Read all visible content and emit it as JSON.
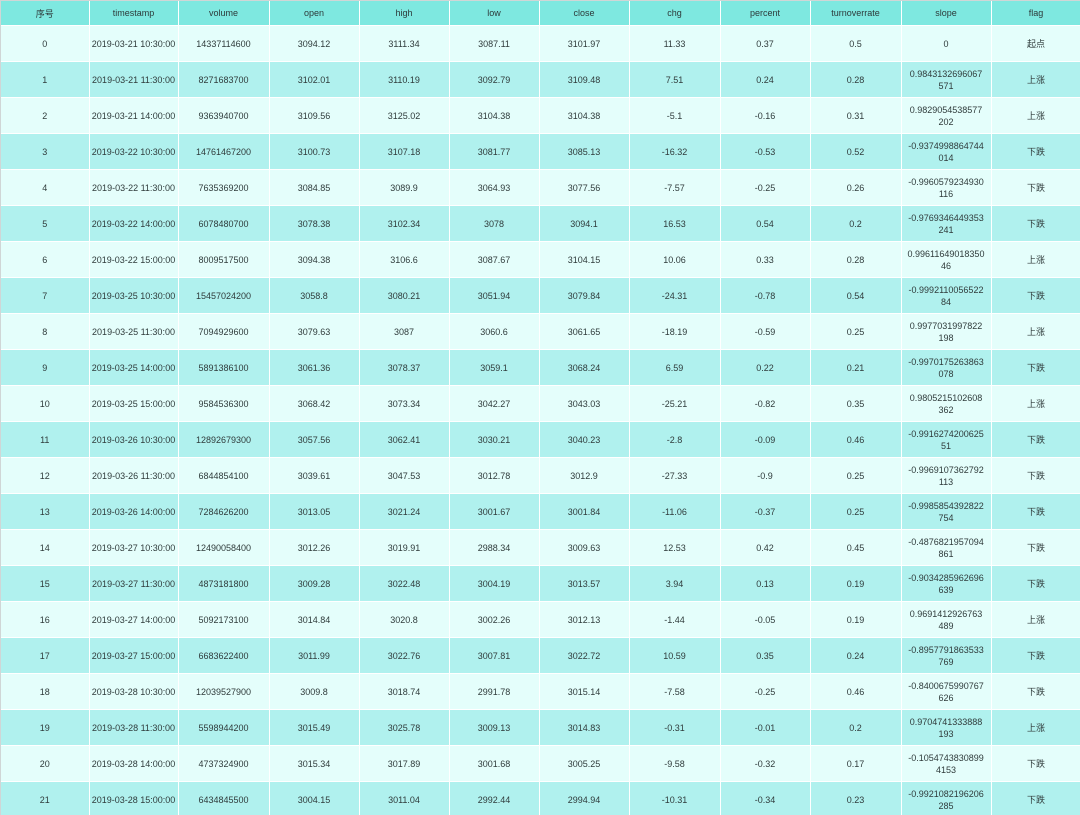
{
  "table": {
    "columns": [
      "序号",
      "timestamp",
      "volume",
      "open",
      "high",
      "low",
      "close",
      "chg",
      "percent",
      "turnoverrate",
      "slope",
      "flag"
    ],
    "rows": [
      [
        "0",
        "2019-03-21 10:30:00",
        "14337114600",
        "3094.12",
        "3111.34",
        "3087.11",
        "3101.97",
        "11.33",
        "0.37",
        "0.5",
        "0",
        "起点"
      ],
      [
        "1",
        "2019-03-21 11:30:00",
        "8271683700",
        "3102.01",
        "3110.19",
        "3092.79",
        "3109.48",
        "7.51",
        "0.24",
        "0.28",
        "0.9843132696067571",
        "上涨"
      ],
      [
        "2",
        "2019-03-21 14:00:00",
        "9363940700",
        "3109.56",
        "3125.02",
        "3104.38",
        "3104.38",
        "-5.1",
        "-0.16",
        "0.31",
        "0.9829054538577202",
        "上涨"
      ],
      [
        "3",
        "2019-03-22 10:30:00",
        "14761467200",
        "3100.73",
        "3107.18",
        "3081.77",
        "3085.13",
        "-16.32",
        "-0.53",
        "0.52",
        "-0.9374998864744014",
        "下跌"
      ],
      [
        "4",
        "2019-03-22 11:30:00",
        "7635369200",
        "3084.85",
        "3089.9",
        "3064.93",
        "3077.56",
        "-7.57",
        "-0.25",
        "0.26",
        "-0.9960579234930116",
        "下跌"
      ],
      [
        "5",
        "2019-03-22 14:00:00",
        "6078480700",
        "3078.38",
        "3102.34",
        "3078",
        "3094.1",
        "16.53",
        "0.54",
        "0.2",
        "-0.9769346449353241",
        "下跌"
      ],
      [
        "6",
        "2019-03-22 15:00:00",
        "8009517500",
        "3094.38",
        "3106.6",
        "3087.67",
        "3104.15",
        "10.06",
        "0.33",
        "0.28",
        "0.9961164901835046",
        "上涨"
      ],
      [
        "7",
        "2019-03-25 10:30:00",
        "15457024200",
        "3058.8",
        "3080.21",
        "3051.94",
        "3079.84",
        "-24.31",
        "-0.78",
        "0.54",
        "-0.999211005652284",
        "下跌"
      ],
      [
        "8",
        "2019-03-25 11:30:00",
        "7094929600",
        "3079.63",
        "3087",
        "3060.6",
        "3061.65",
        "-18.19",
        "-0.59",
        "0.25",
        "0.9977031997822198",
        "上涨"
      ],
      [
        "9",
        "2019-03-25 14:00:00",
        "5891386100",
        "3061.36",
        "3078.37",
        "3059.1",
        "3068.24",
        "6.59",
        "0.22",
        "0.21",
        "-0.9970175263863078",
        "下跌"
      ],
      [
        "10",
        "2019-03-25 15:00:00",
        "9584536300",
        "3068.42",
        "3073.34",
        "3042.27",
        "3043.03",
        "-25.21",
        "-0.82",
        "0.35",
        "0.9805215102608362",
        "上涨"
      ],
      [
        "11",
        "2019-03-26 10:30:00",
        "12892679300",
        "3057.56",
        "3062.41",
        "3030.21",
        "3040.23",
        "-2.8",
        "-0.09",
        "0.46",
        "-0.991627420062551",
        "下跌"
      ],
      [
        "12",
        "2019-03-26 11:30:00",
        "6844854100",
        "3039.61",
        "3047.53",
        "3012.78",
        "3012.9",
        "-27.33",
        "-0.9",
        "0.25",
        "-0.9969107362792113",
        "下跌"
      ],
      [
        "13",
        "2019-03-26 14:00:00",
        "7284626200",
        "3013.05",
        "3021.24",
        "3001.67",
        "3001.84",
        "-11.06",
        "-0.37",
        "0.25",
        "-0.9985854392822754",
        "下跌"
      ],
      [
        "14",
        "2019-03-27 10:30:00",
        "12490058400",
        "3012.26",
        "3019.91",
        "2988.34",
        "3009.63",
        "12.53",
        "0.42",
        "0.45",
        "-0.4876821957094861",
        "下跌"
      ],
      [
        "15",
        "2019-03-27 11:30:00",
        "4873181800",
        "3009.28",
        "3022.48",
        "3004.19",
        "3013.57",
        "3.94",
        "0.13",
        "0.19",
        "-0.9034285962696639",
        "下跌"
      ],
      [
        "16",
        "2019-03-27 14:00:00",
        "5092173100",
        "3014.84",
        "3020.8",
        "3002.26",
        "3012.13",
        "-1.44",
        "-0.05",
        "0.19",
        "0.9691412926763489",
        "上涨"
      ],
      [
        "17",
        "2019-03-27 15:00:00",
        "6683622400",
        "3011.99",
        "3022.76",
        "3007.81",
        "3022.72",
        "10.59",
        "0.35",
        "0.24",
        "-0.8957791863533769",
        "下跌"
      ],
      [
        "18",
        "2019-03-28 10:30:00",
        "12039527900",
        "3009.8",
        "3018.74",
        "2991.78",
        "3015.14",
        "-7.58",
        "-0.25",
        "0.46",
        "-0.8400675990767626",
        "下跌"
      ],
      [
        "19",
        "2019-03-28 11:30:00",
        "5598944200",
        "3015.49",
        "3025.78",
        "3009.13",
        "3014.83",
        "-0.31",
        "-0.01",
        "0.2",
        "0.9704741333888193",
        "上涨"
      ],
      [
        "20",
        "2019-03-28 14:00:00",
        "4737324900",
        "3015.34",
        "3017.89",
        "3001.68",
        "3005.25",
        "-9.58",
        "-0.32",
        "0.17",
        "-0.10547438308994153",
        "下跌"
      ],
      [
        "21",
        "2019-03-28 15:00:00",
        "6434845500",
        "3004.15",
        "3011.04",
        "2992.44",
        "2994.94",
        "-10.31",
        "-0.34",
        "0.23",
        "-0.9921082196206285",
        "下跌"
      ]
    ]
  },
  "colors": {
    "header_bg": "#7ee8e0",
    "row_light": "#e4fefb",
    "row_dark": "#b0f1ee",
    "text": "#2f3b3b"
  }
}
